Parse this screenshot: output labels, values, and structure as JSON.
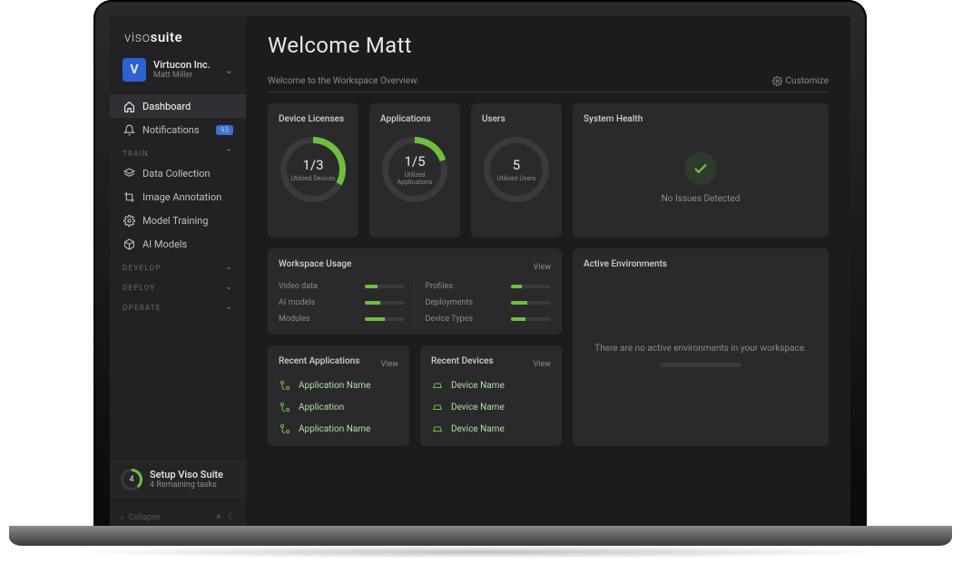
{
  "brand": {
    "left": "viso",
    "right": "suite"
  },
  "org": {
    "letter": "V",
    "name": "Virtucon Inc.",
    "user": "Matt Miller"
  },
  "nav": {
    "dashboard": "Dashboard",
    "notifications": "Notifications",
    "notif_badge": "93"
  },
  "sections": {
    "train": "Train",
    "develop": "Develop",
    "deploy": "Deploy",
    "operate": "Operate"
  },
  "train_items": {
    "data_collection": "Data Collection",
    "image_annotation": "Image Annotation",
    "model_training": "Model Training",
    "ai_models": "AI Models"
  },
  "setup": {
    "count": "4",
    "title": "Setup Viso Suite",
    "sub": "4 Remaining tasks"
  },
  "collapse": "Collapse",
  "header": "Welcome Matt",
  "subheader": "Welcome to the Workspace Overview.",
  "customize": "Customize",
  "cards": {
    "licenses": {
      "title": "Device Licenses",
      "value": "1/3",
      "sub": "Utilized\nDevices",
      "pct": 33
    },
    "apps": {
      "title": "Applications",
      "value": "1/5",
      "sub": "Utilized\nApplications",
      "pct": 20
    },
    "users": {
      "title": "Users",
      "value": "5",
      "sub": "Utilized\nUsers",
      "pct": 0
    }
  },
  "health": {
    "title": "System Health",
    "msg": "No Issues Detected"
  },
  "usage": {
    "title": "Workspace Usage",
    "view": "View",
    "left": [
      {
        "label": "Video data",
        "pct": 32
      },
      {
        "label": "AI models",
        "pct": 40
      },
      {
        "label": "Modules",
        "pct": 52
      }
    ],
    "right": [
      {
        "label": "Profiles",
        "pct": 28
      },
      {
        "label": "Deployments",
        "pct": 40
      },
      {
        "label": "Device Types",
        "pct": 36
      }
    ]
  },
  "env": {
    "title": "Active Environments",
    "msg": "There are no active environments in your workspace."
  },
  "recent_apps": {
    "title": "Recent Applications",
    "view": "View",
    "items": [
      "Application Name",
      "Application",
      "Application Name"
    ]
  },
  "recent_devices": {
    "title": "Recent Devices",
    "view": "View",
    "items": [
      "Device Name",
      "Device Name",
      "Device Name"
    ]
  }
}
